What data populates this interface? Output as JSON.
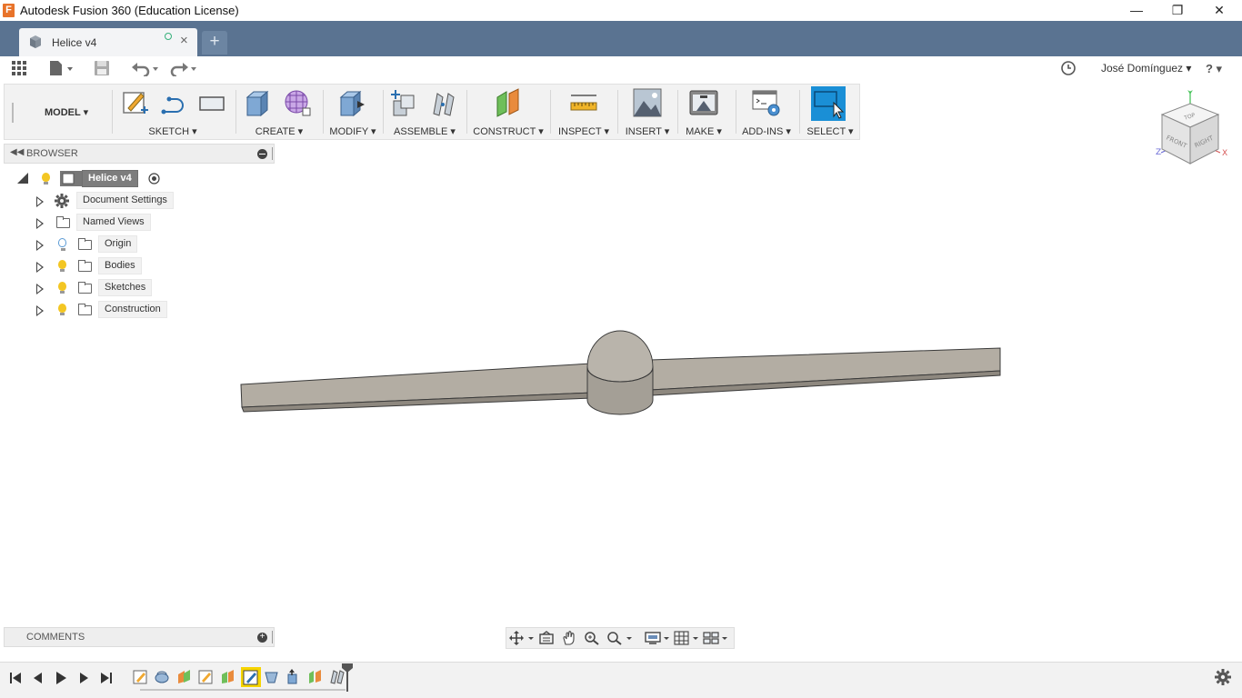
{
  "window": {
    "title": "Autodesk Fusion 360 (Education License)",
    "logo_letter": "F",
    "minimize": "—",
    "maximize": "❐",
    "close": "✕"
  },
  "tabs": {
    "active_label": "Helice v4",
    "new_tab": "+"
  },
  "user": {
    "name": "José Domínguez ▾",
    "help": "? ▾"
  },
  "ribbon": {
    "workspace": "MODEL ▾",
    "groups": [
      {
        "label": "SKETCH ▾"
      },
      {
        "label": "CREATE ▾"
      },
      {
        "label": "MODIFY ▾"
      },
      {
        "label": "ASSEMBLE ▾"
      },
      {
        "label": "CONSTRUCT ▾"
      },
      {
        "label": "INSPECT ▾"
      },
      {
        "label": "INSERT ▾"
      },
      {
        "label": "MAKE ▾"
      },
      {
        "label": "ADD-INS ▾"
      },
      {
        "label": "SELECT ▾"
      }
    ]
  },
  "browser": {
    "title": "BROWSER",
    "root": "Helice v4",
    "items": [
      {
        "label": "Document Settings"
      },
      {
        "label": "Named Views"
      },
      {
        "label": "Origin"
      },
      {
        "label": "Bodies"
      },
      {
        "label": "Sketches"
      },
      {
        "label": "Construction"
      }
    ]
  },
  "viewcube": {
    "top": "TOP",
    "front": "FRONT",
    "right": "RIGHT",
    "axis_x": "X",
    "axis_y": "Y",
    "axis_z": "Z"
  },
  "comments": {
    "title": "COMMENTS"
  },
  "colors": {
    "tab_bar": "#5a7391",
    "select_accent": "#1a8fd6",
    "model_fill": "#b3ada3"
  }
}
